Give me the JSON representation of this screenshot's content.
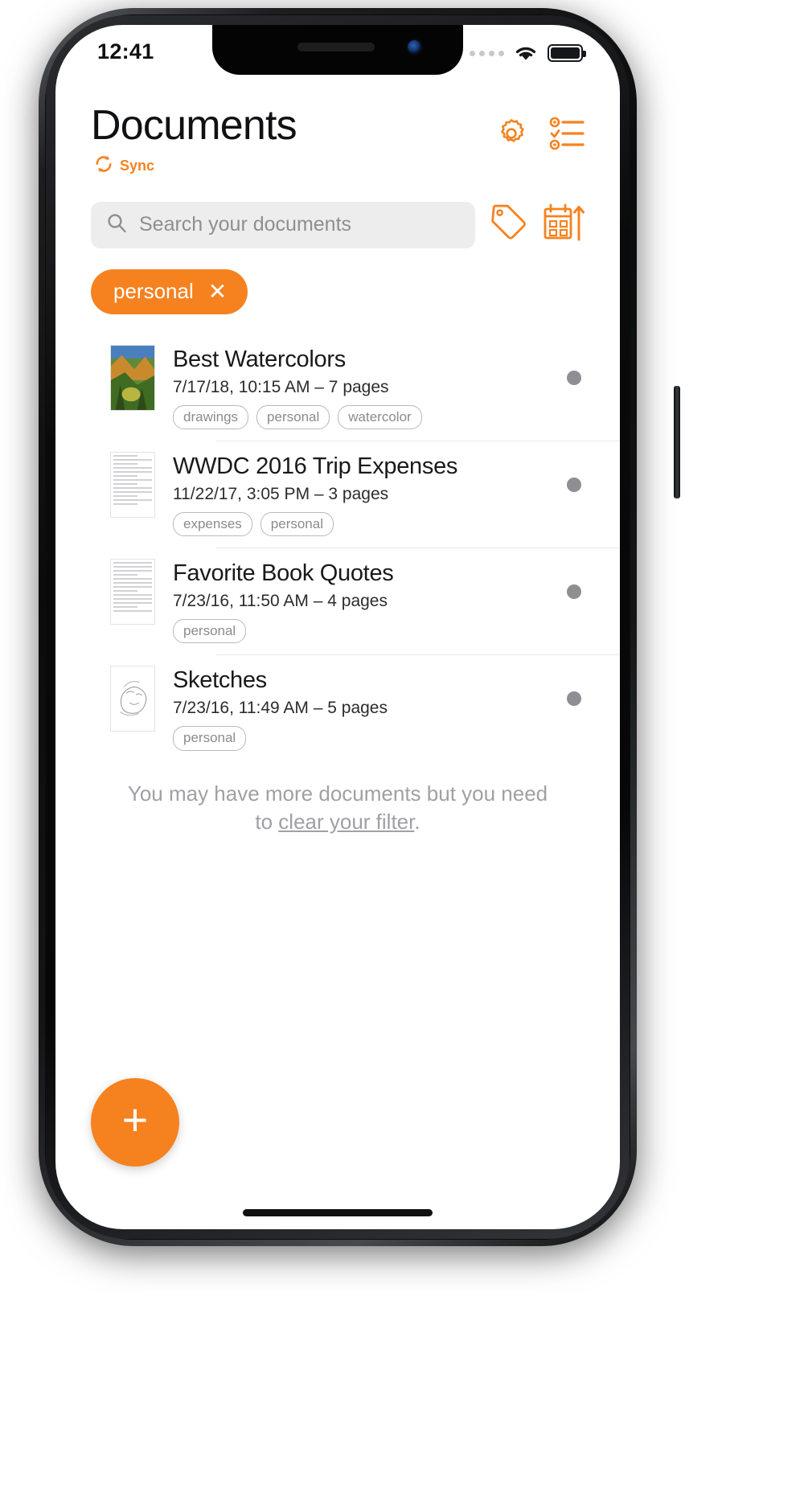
{
  "status_bar": {
    "time": "12:41",
    "signal_icon": "signal-dots-icon",
    "wifi_icon": "wifi-icon",
    "battery_icon": "battery-full-icon"
  },
  "header": {
    "title": "Documents",
    "sync_label": "Sync",
    "sync_icon": "sync-refresh-icon",
    "settings_icon": "gear-icon",
    "checklist_icon": "checklist-icon"
  },
  "search": {
    "placeholder": "Search your documents",
    "value": "",
    "search_icon": "search-icon",
    "tag_icon": "tag-icon",
    "sort_icon": "sort-by-date-ascending-icon"
  },
  "filters": [
    {
      "label": "personal",
      "remove_icon": "close-icon",
      "remove_label": "✕"
    }
  ],
  "documents": [
    {
      "title": "Best Watercolors",
      "meta": "7/17/18, 10:15 AM – 7 pages",
      "tags": [
        "drawings",
        "personal",
        "watercolor"
      ],
      "thumbnail": "watercolor-painting-thumbnail"
    },
    {
      "title": "WWDC 2016 Trip Expenses",
      "meta": "11/22/17, 3:05 PM – 3 pages",
      "tags": [
        "expenses",
        "personal"
      ],
      "thumbnail": "receipt-scan-thumbnail"
    },
    {
      "title": "Favorite Book Quotes",
      "meta": "7/23/16, 11:50 AM – 4 pages",
      "tags": [
        "personal"
      ],
      "thumbnail": "text-page-thumbnail"
    },
    {
      "title": "Sketches",
      "meta": "7/23/16, 11:49 AM – 5 pages",
      "tags": [
        "personal"
      ],
      "thumbnail": "pencil-sketch-thumbnail"
    }
  ],
  "footer_note": {
    "text_before": "You may have more documents but you need to ",
    "link_text": "clear your filter",
    "text_after": "."
  },
  "fab": {
    "label": "+",
    "icon": "plus-icon"
  },
  "colors": {
    "accent": "#f5821f",
    "text_primary": "#18191b",
    "text_muted": "#8e8e93",
    "search_bg": "#ededee"
  }
}
